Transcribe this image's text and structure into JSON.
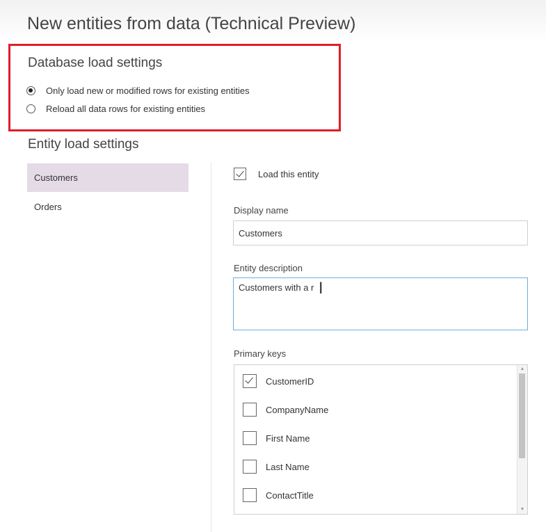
{
  "page": {
    "title": "New entities from data (Technical Preview)"
  },
  "database_load": {
    "heading": "Database load settings",
    "options": [
      {
        "label": "Only load new or modified rows for existing entities",
        "selected": true
      },
      {
        "label": "Reload all data rows for existing entities",
        "selected": false
      }
    ]
  },
  "entity_load": {
    "heading": "Entity load settings",
    "entities": [
      {
        "label": "Customers",
        "selected": true
      },
      {
        "label": "Orders",
        "selected": false
      }
    ]
  },
  "detail": {
    "load_entity": {
      "label": "Load this entity",
      "checked": true
    },
    "display_name": {
      "label": "Display name",
      "value": "Customers"
    },
    "entity_description": {
      "label": "Entity description",
      "value": "Customers with a r"
    },
    "primary_keys": {
      "label": "Primary keys",
      "items": [
        {
          "label": "CustomerID",
          "checked": true
        },
        {
          "label": "CompanyName",
          "checked": false
        },
        {
          "label": "First Name",
          "checked": false
        },
        {
          "label": "Last Name",
          "checked": false
        },
        {
          "label": "ContactTitle",
          "checked": false
        }
      ]
    }
  },
  "icons": {
    "text_cursor": "I-beam-cursor-icon",
    "scroll_up": "chevron-up-icon",
    "scroll_down": "chevron-down-icon"
  },
  "colors": {
    "highlight": "#e01d2a",
    "selected_item": "#e4dbe7",
    "focus_border": "#6aaee0"
  }
}
